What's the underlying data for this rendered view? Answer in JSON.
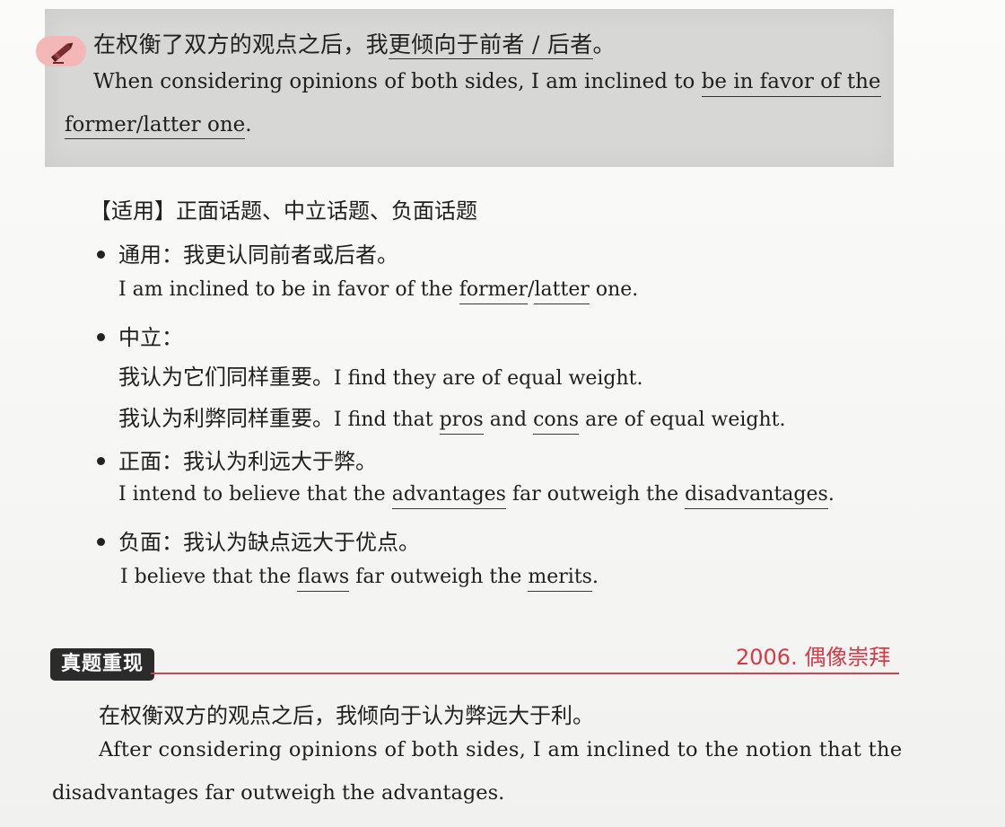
{
  "top_phrase": {
    "cn_pre": "在权衡了双方的观点之后，我",
    "cn_u": "更倾向于前者 / 后者",
    "cn_post": "。",
    "en_line1_pre": "When considering opinions of both sides, I am inclined to ",
    "en_line1_u": "be in favor of the",
    "en_line2_u": "former/latter one",
    "en_line2_post": "."
  },
  "usage": {
    "label": "【适用】正面话题、中立话题、负面话题",
    "general": {
      "cn": "通用：我更认同前者或后者。",
      "en_pre": "I am inclined to be in favor of the ",
      "en_u1": "former",
      "en_mid": "/",
      "en_u2": "latter",
      "en_post": " one."
    },
    "neutral": {
      "cn": "中立：",
      "s1_cn": "我认为它们同样重要。",
      "s1_en": "I find they are of equal weight.",
      "s2_cn": "我认为利弊同样重要。",
      "s2_en_pre": "I find that ",
      "s2_u1": "pros",
      "s2_mid": " and ",
      "s2_u2": "cons",
      "s2_post": " are of equal weight."
    },
    "positive": {
      "cn": "正面：我认为利远大于弊。",
      "en_pre": "I intend to believe that the ",
      "en_u1": "advantages",
      "en_mid": " far outweigh the ",
      "en_u2": "disadvantages",
      "en_post": "."
    },
    "negative": {
      "cn": "负面：我认为缺点远大于优点。",
      "en_pre": "I believe that the ",
      "en_u1": "flaws",
      "en_mid": " far outweigh the ",
      "en_u2": "merits",
      "en_post": "."
    }
  },
  "exam": {
    "tag": "真题重现",
    "year_topic": "2006. 偶像崇拜",
    "cn": "在权衡双方的观点之后，我倾向于认为弊远大于利。",
    "en_line1": "After considering opinions of both sides, I am inclined to the notion that the",
    "en_line2": "disadvantages far outweigh the advantages."
  },
  "colors": {
    "box_gray": "#d7d7d5",
    "badge_pink": "#f2b7b6",
    "accent_red": "#d63a47",
    "tag_dark": "#2b2b2b"
  },
  "icons": [
    "pencil-icon"
  ]
}
